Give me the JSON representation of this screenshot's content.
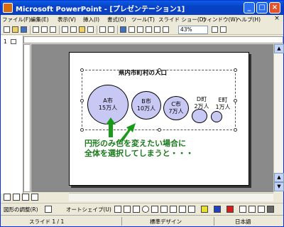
{
  "window": {
    "title": "Microsoft PowerPoint - [プレゼンテーション1]",
    "buttons": {
      "minimize": "_",
      "maximize": "□",
      "close": "×"
    }
  },
  "menu": {
    "items": [
      "ファイル(F)",
      "編集(E)",
      "表示(V)",
      "挿入(I)",
      "書式(O)",
      "ツール(T)",
      "スライド ショー(D)",
      "ウィンドウ(W)",
      "ヘルプ(H)"
    ],
    "close_mdi": "×"
  },
  "toolbar": {
    "zoom": "43%"
  },
  "outline": {
    "slide_number": "1"
  },
  "slide": {
    "title": "県内市町村の人口",
    "circles": [
      {
        "name": "A市",
        "pop": "15万人"
      },
      {
        "name": "B市",
        "pop": "10万人"
      },
      {
        "name": "C市",
        "pop": "7万人"
      },
      {
        "name": "D町",
        "pop": "2万人"
      },
      {
        "name": "E町",
        "pop": "1万人"
      }
    ],
    "annotation_line1": "円形のみ色を変えたい場合に",
    "annotation_line2": "全体を選択してしまうと・・・"
  },
  "drawbar": {
    "draw_menu": "図形の調整(R)",
    "autoshapes": "オートシェイプ(U)"
  },
  "status": {
    "slide": "スライド 1 / 1",
    "design": "標準デザイン",
    "language": "日本語"
  },
  "colors": {
    "circle_fill": "#c8c8f4",
    "annotation": "#1a7a1a",
    "titlebar": "#0a5fe6"
  }
}
